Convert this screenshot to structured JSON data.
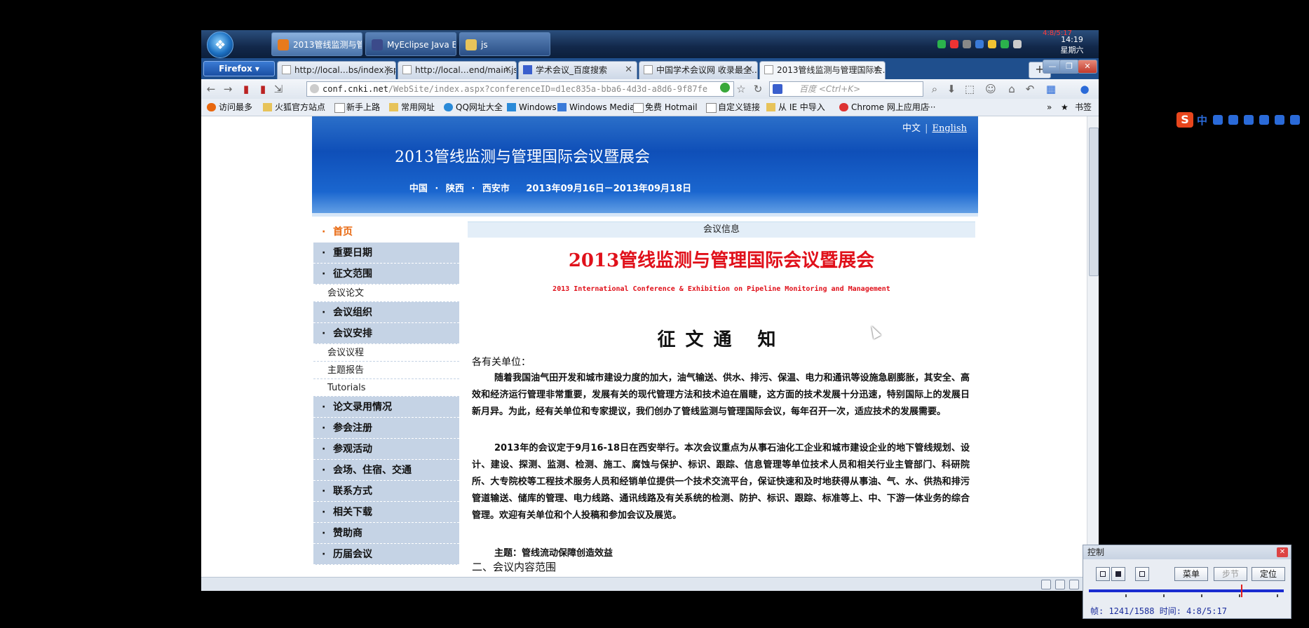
{
  "taskbar": {
    "tasks": [
      {
        "label": "2013管线监测与管...",
        "active": true
      },
      {
        "label": "MyEclipse Java E..."
      },
      {
        "label": "js"
      }
    ],
    "clock_time": "14:19",
    "clock_day": "星期六",
    "clock_red": "4:8/5:17"
  },
  "browser": {
    "menu_label": "Firefox ▾",
    "tabs": [
      {
        "title": "http://local…bs/index.jsp"
      },
      {
        "title": "http://local…end/main.jsp"
      },
      {
        "title": "学术会议_百度搜索"
      },
      {
        "title": "中国学术会议网 收录最全…"
      },
      {
        "title": "2013管线监测与管理国际会…",
        "selected": true
      }
    ],
    "new_tab": "+",
    "url_host": "conf.cnki.net",
    "url_path": "/WebSite/index.aspx?conferenceID=d1ec835a-bba6-4d3d-a8d6-9f87fe",
    "search_placeholder": "百度 <Ctrl+K>",
    "bookmarks": [
      "访问最多",
      "火狐官方站点",
      "新手上路",
      "常用网址",
      "QQ网址大全",
      "Windows",
      "Windows Media",
      "免费 Hotmail",
      "自定义链接",
      "从 IE 中导入",
      "Chrome 网上应用店",
      "···"
    ],
    "bookmarks_label": "书签",
    "bookmarks_more": "»"
  },
  "page": {
    "lang_zh": "中文",
    "lang_sep": "|",
    "lang_en": "English",
    "banner_title": "2013管线监测与管理国际会议暨展会",
    "banner_sub": "中国 · 陕西 · 西安市 　2013年09月16日－2013年09月18日",
    "menu": [
      {
        "label": "首页",
        "type": "home"
      },
      {
        "label": "重要日期",
        "type": "main"
      },
      {
        "label": "征文范围",
        "type": "main"
      },
      {
        "label": "会议论文",
        "type": "sub"
      },
      {
        "label": "会议组织",
        "type": "main"
      },
      {
        "label": "会议安排",
        "type": "main"
      },
      {
        "label": "会议议程",
        "type": "sub"
      },
      {
        "label": "主题报告",
        "type": "sub"
      },
      {
        "label": "Tutorials",
        "type": "sub"
      },
      {
        "label": "论文录用情况",
        "type": "main"
      },
      {
        "label": "参会注册",
        "type": "main"
      },
      {
        "label": "参观活动",
        "type": "main"
      },
      {
        "label": "会场、住宿、交通",
        "type": "main"
      },
      {
        "label": "联系方式",
        "type": "main"
      },
      {
        "label": "相关下载",
        "type": "main"
      },
      {
        "label": "赞助商",
        "type": "main"
      },
      {
        "label": "历届会议",
        "type": "main"
      }
    ],
    "info_bar": "会议信息",
    "conf_title": "2013管线监测与管理国际会议暨展会",
    "conf_en": "2013 International Conference & Exhibition on Pipeline Monitoring and Management",
    "notice_title": "征文通 知",
    "greeting": "各有关单位：",
    "para1": "随着我国油气田开发和城市建设力度的加大，油气输送、供水、排污、保温、电力和通讯等设施急剧膨胀，其安全、高效和经济运行管理非常重要，发展有关的现代管理方法和技术迫在眉睫，这方面的技术发展十分迅速，特别国际上的发展日新月异。为此，经有关单位和专家提议，我们创办了管线监测与管理国际会议，每年召开一次，适应技术的发展需要。",
    "para2": "2013年的会议定于9月16-18日在西安举行。本次会议重点为从事石油化工企业和城市建设企业的地下管线规划、设计、建设、探测、监测、检测、施工、腐蚀与保护、标识、跟踪、信息管理等单位技术人员和相关行业主管部门、科研院所、大专院校等工程技术服务人员和经销单位提供一个技术交流平台，保证快速和及时地获得从事油、气、水、供热和排污管道输送、储库的管理、电力线路、通讯线路及有关系统的检测、防护、标识、跟踪、标准等上、中、下游一体业务的综合管理。欢迎有关单位和个人投稿和参加会议及展览。",
    "theme": "主题：管线流动保障创造效益",
    "section2": "二、会议内容范围"
  },
  "ime": {
    "zh": "中"
  },
  "control_panel": {
    "title": "控制",
    "menu_label": "菜单",
    "step_label": "步节",
    "locate_label": "定位",
    "status": "帧: 1241/1588 时间: 4:8/5:17",
    "progress": 0.78
  },
  "colors": {
    "accent_red": "#e0101a",
    "banner_blue": "#0f4fb8",
    "menu_bg": "#c5d3e5",
    "home_orange": "#e8670e"
  }
}
